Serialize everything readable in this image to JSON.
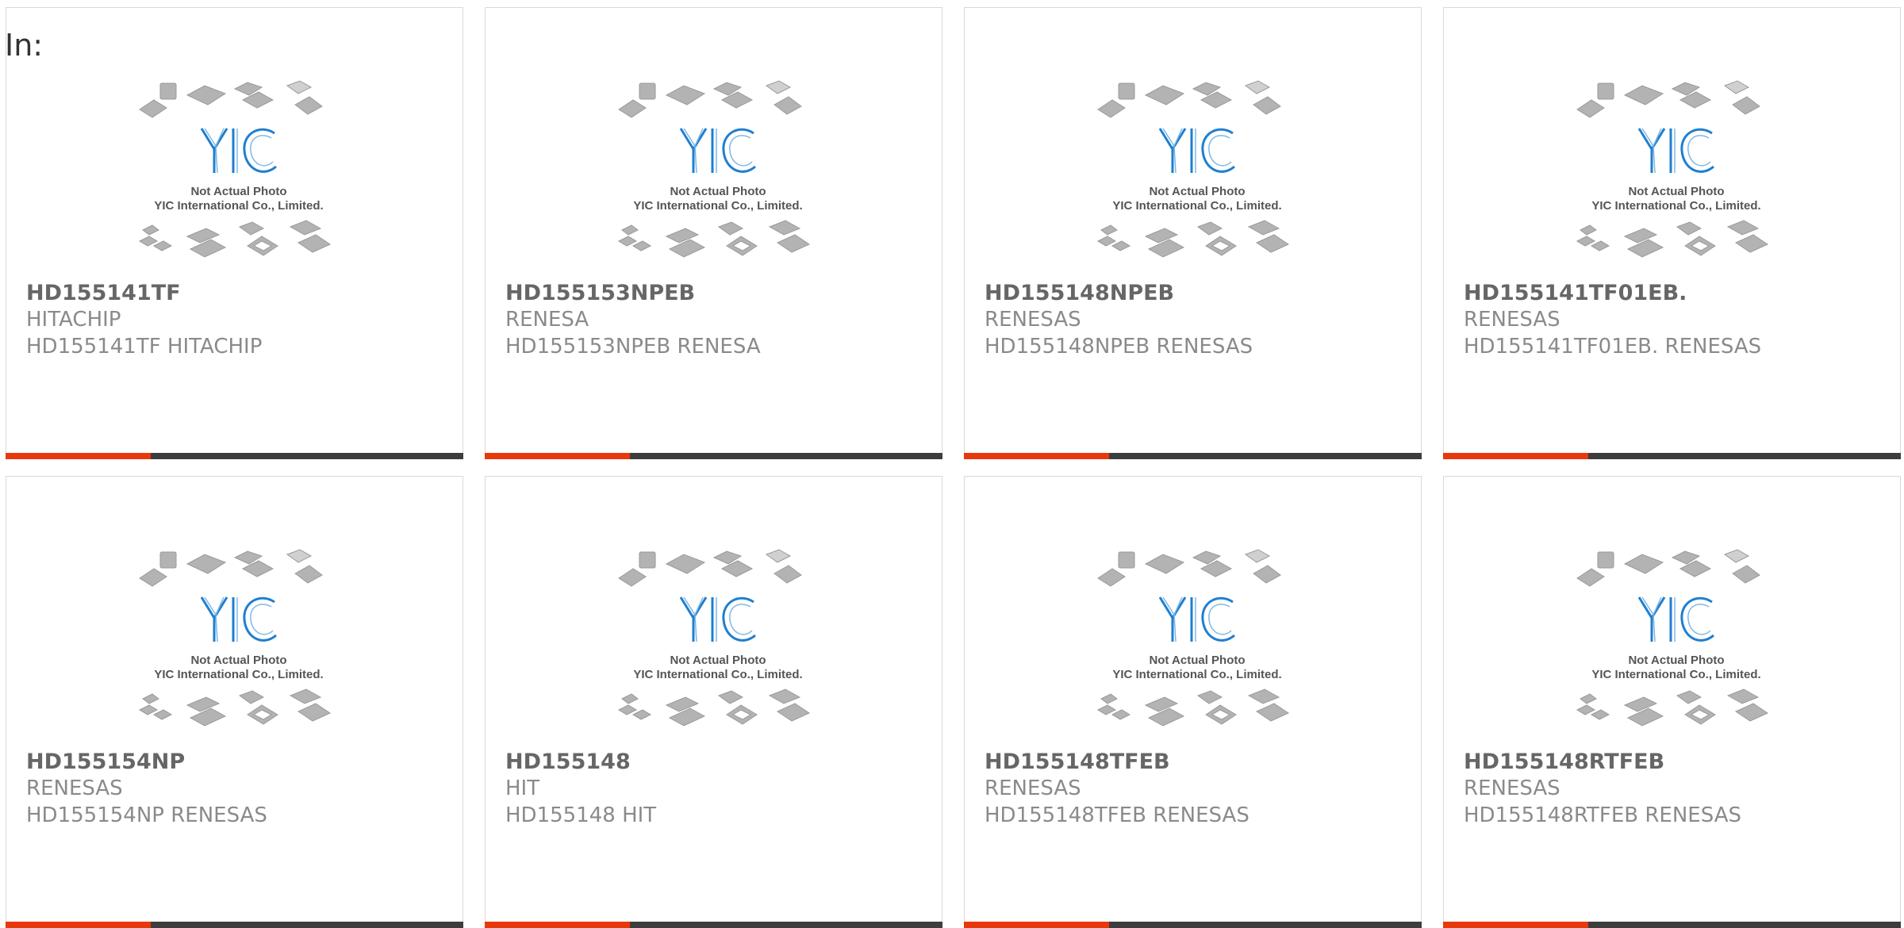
{
  "page": {
    "label": "In:"
  },
  "placeholder": {
    "logo_text": "YIC",
    "line1": "Not Actual Photo",
    "line2": "YIC International Co., Limited."
  },
  "colors": {
    "accent": "#e8380d",
    "bar": "#3d3d3d",
    "logo_blue": "#1f7fd0",
    "text_bold": "#666666",
    "text_light": "#8a8a8a"
  },
  "products": [
    {
      "part": "HD155141TF",
      "maker": "HITACHIP",
      "desc": "HD155141TF HITACHIP"
    },
    {
      "part": "HD155153NPEB",
      "maker": "RENESA",
      "desc": "HD155153NPEB RENESA"
    },
    {
      "part": "HD155148NPEB",
      "maker": "RENESAS",
      "desc": "HD155148NPEB RENESAS"
    },
    {
      "part": "HD155141TF01EB.",
      "maker": "RENESAS",
      "desc": "HD155141TF01EB. RENESAS"
    },
    {
      "part": "HD155154NP",
      "maker": "RENESAS",
      "desc": "HD155154NP RENESAS"
    },
    {
      "part": "HD155148",
      "maker": "HIT",
      "desc": "HD155148 HIT"
    },
    {
      "part": "HD155148TFEB",
      "maker": "RENESAS",
      "desc": "HD155148TFEB RENESAS"
    },
    {
      "part": "HD155148RTFEB",
      "maker": "RENESAS",
      "desc": "HD155148RTFEB RENESAS"
    }
  ]
}
